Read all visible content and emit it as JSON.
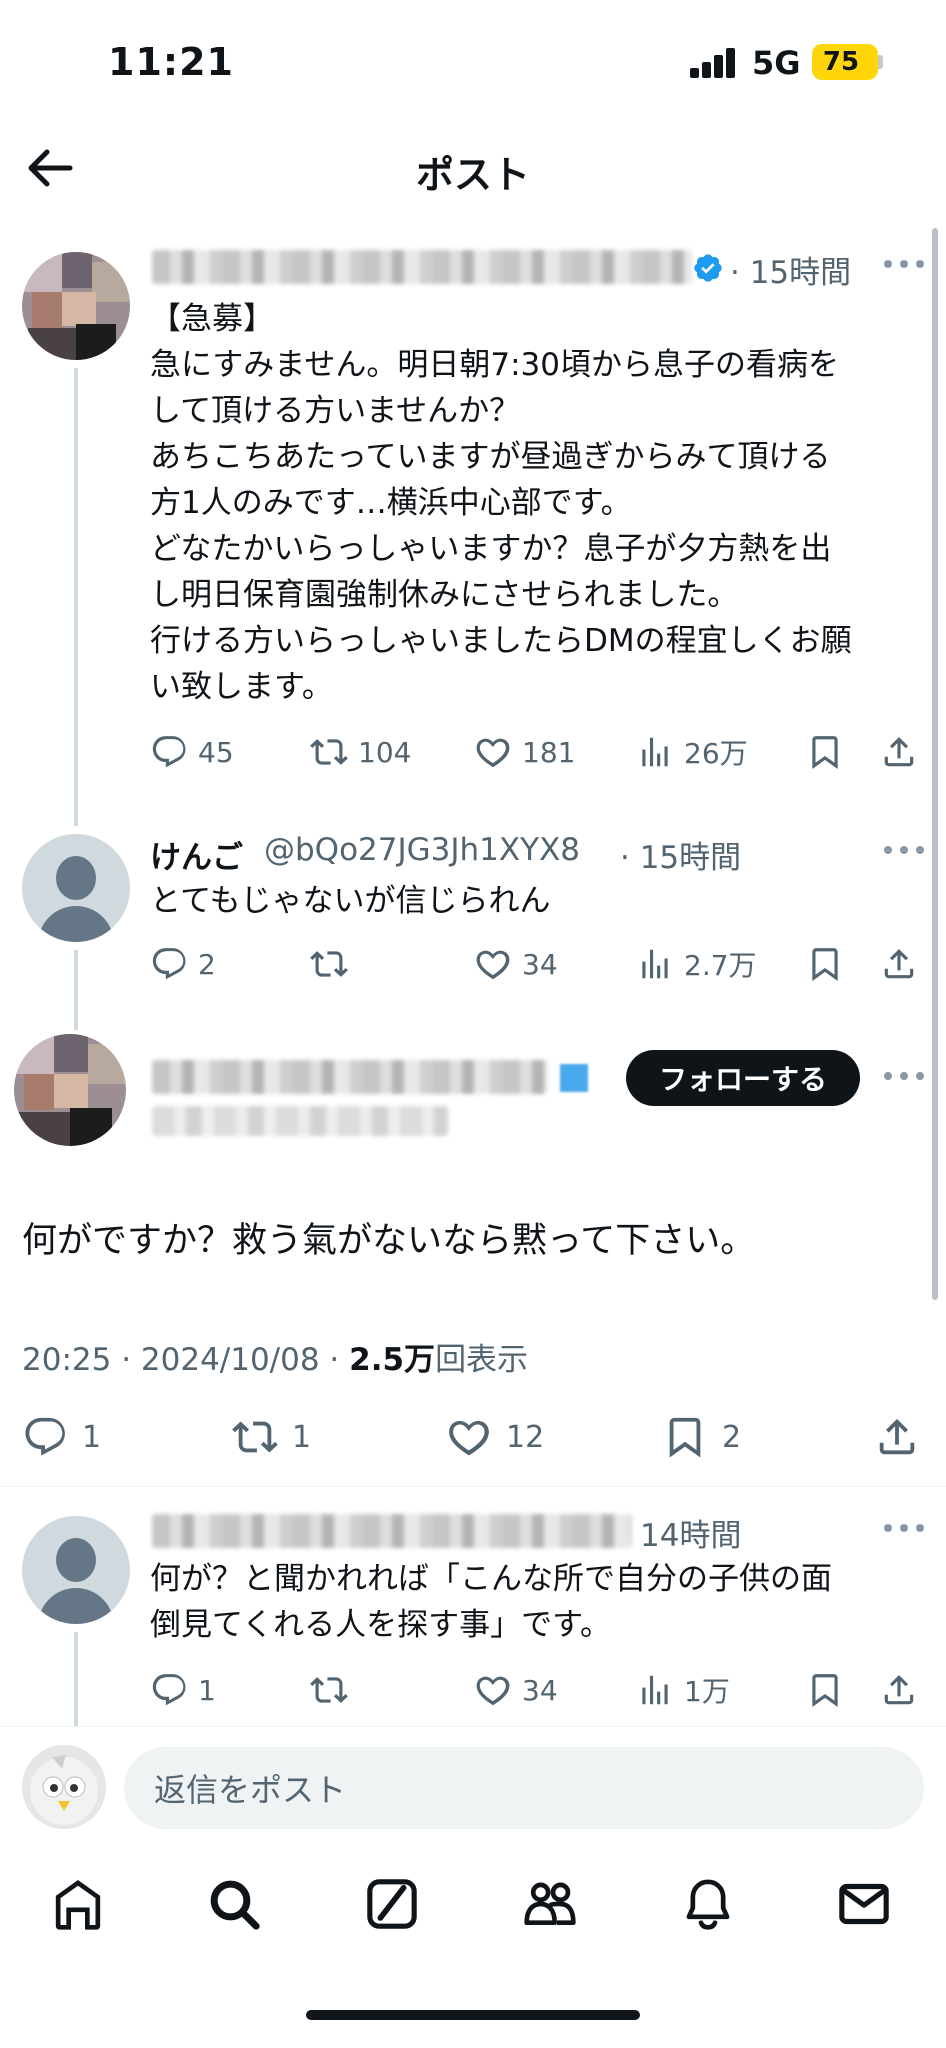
{
  "status_bar": {
    "time": "11:21",
    "network": "5G",
    "battery": "75"
  },
  "header": {
    "title": "ポスト"
  },
  "tweet1": {
    "time": "· 15時間",
    "lines": [
      "【急募】",
      "急にすみません。明日朝7:30頃から息子の看病を",
      "して頂ける方いませんか？",
      "あちこちあたっていますが昼過ぎからみて頂ける",
      "方1人のみです…横浜中心部です。",
      "どなたかいらっしゃいますか？息子が夕方熱を出",
      "し明日保育園強制休みにさせられました。",
      "行ける方いらっしゃいましたらDMの程宜しくお願",
      "い致します。"
    ],
    "stats": {
      "replies": "45",
      "reposts": "104",
      "likes": "181",
      "views": "26万"
    }
  },
  "tweet2": {
    "name": "けんご",
    "handle": "@bQo27JG3Jh1XYX8",
    "time": "· 15時間",
    "text": "とてもじゃないが信じられん",
    "stats": {
      "replies": "2",
      "likes": "34",
      "views": "2.7万"
    }
  },
  "focus": {
    "follow_label": "フォローする",
    "text": "何がですか？救う氣がないなら黙って下さい。",
    "timestamp": "20:25 · 2024/10/08 · ",
    "views_count": "2.5万",
    "views_label": "回表示",
    "stats": {
      "replies": "1",
      "reposts": "1",
      "likes": "12",
      "bookmarks": "2"
    }
  },
  "tweet4": {
    "time": "14時間",
    "lines": [
      "何が？と聞かれれば「こんな所で自分の子供の面",
      "倒見てくれる人を探す事」です。"
    ],
    "stats": {
      "replies": "1",
      "likes": "34",
      "views": "1万"
    }
  },
  "reply_bar": {
    "placeholder": "返信をポスト"
  },
  "icons": {
    "back": "arrow-left-icon",
    "verified": "verified-badge-icon",
    "reply": "comment-icon",
    "repost": "repost-icon",
    "like": "heart-icon",
    "views": "bar-chart-icon",
    "bookmark": "bookmark-icon",
    "share": "share-icon",
    "tabs": [
      "home-icon",
      "search-icon",
      "grok-icon",
      "communities-icon",
      "bell-icon",
      "mail-icon"
    ]
  },
  "colors": {
    "verified": "#1d9bf0",
    "text": "#0f1419",
    "secondary": "#536471",
    "battery": "#ffd60a"
  }
}
